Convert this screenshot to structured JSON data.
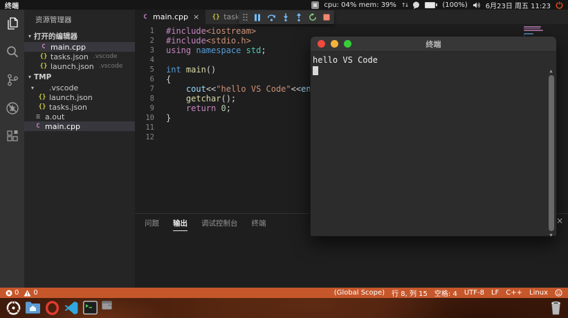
{
  "topbar": {
    "app": "终端",
    "cpu_mem": "cpu: 04% mem: 39%",
    "battery": "(100%)",
    "clock": "6月23日 周五 11:23"
  },
  "activity_bar": {
    "items": [
      {
        "name": "explorer",
        "icon": "files",
        "active": true
      },
      {
        "name": "search",
        "icon": "search",
        "active": false
      },
      {
        "name": "source-control",
        "icon": "git",
        "active": false
      },
      {
        "name": "debug",
        "icon": "debug",
        "active": false
      },
      {
        "name": "extensions",
        "icon": "extensions",
        "active": false
      }
    ]
  },
  "sidebar": {
    "title": "资源管理器",
    "open_editors_label": "打开的编辑器",
    "open_editors": [
      {
        "icon": "cpp",
        "label": "main.cpp",
        "selected": true
      },
      {
        "icon": "json",
        "label": "tasks.json",
        "suffix": ".vscode"
      },
      {
        "icon": "json",
        "label": "launch.json",
        "suffix": ".vscode"
      }
    ],
    "folder_label": "TMP",
    "tree": [
      {
        "icon": "folder",
        "label": ".vscode",
        "indent": 1,
        "arrow": true
      },
      {
        "icon": "json",
        "label": "launch.json",
        "indent": 2
      },
      {
        "icon": "json",
        "label": "tasks.json",
        "indent": 2
      },
      {
        "icon": "binary",
        "label": "a.out",
        "indent": 1
      },
      {
        "icon": "cpp",
        "label": "main.cpp",
        "indent": 1,
        "selected": true
      }
    ]
  },
  "tabs": [
    {
      "icon": "cpp",
      "label": "main.cpp",
      "active": true,
      "close": true
    },
    {
      "icon": "json",
      "label": "tasks.json",
      "active": false,
      "close": false
    }
  ],
  "debug_toolbar": {
    "buttons": [
      "drag-handle",
      "pause",
      "step-over",
      "step-into",
      "step-out",
      "restart",
      "stop"
    ]
  },
  "editor": {
    "token_colors": {
      "pp": "#C586C0",
      "kw": "#569CD6",
      "type": "#4EC9B0",
      "fn": "#DCDCAA",
      "var": "#9CDCFE",
      "str": "#CE9178",
      "num": "#B5CEA8",
      "pl": "#D4D4D4"
    },
    "lines": [
      [
        {
          "t": "#include",
          "c": "pp"
        },
        {
          "t": "<iostream>",
          "c": "str"
        }
      ],
      [
        {
          "t": "#include",
          "c": "pp"
        },
        {
          "t": "<stdio.h>",
          "c": "str"
        }
      ],
      [
        {
          "t": "using",
          "c": "pp"
        },
        {
          "t": " ",
          "c": "pl"
        },
        {
          "t": "namespace",
          "c": "kw"
        },
        {
          "t": " ",
          "c": "pl"
        },
        {
          "t": "std",
          "c": "type"
        },
        {
          "t": ";",
          "c": "pl"
        }
      ],
      [],
      [
        {
          "t": "int",
          "c": "kw"
        },
        {
          "t": " ",
          "c": "pl"
        },
        {
          "t": "main",
          "c": "fn"
        },
        {
          "t": "()",
          "c": "pl"
        }
      ],
      [
        {
          "t": "{",
          "c": "pl"
        }
      ],
      [
        {
          "t": "    ",
          "c": "pl"
        },
        {
          "t": "cout",
          "c": "var"
        },
        {
          "t": "<<",
          "c": "pl"
        },
        {
          "t": "\"hello VS Code\"",
          "c": "str"
        },
        {
          "t": "<<",
          "c": "pl"
        },
        {
          "t": "endl",
          "c": "var"
        },
        {
          "t": ";",
          "c": "pl"
        }
      ],
      [
        {
          "t": "    ",
          "c": "pl"
        },
        {
          "t": "getchar",
          "c": "fn"
        },
        {
          "t": "();",
          "c": "pl"
        }
      ],
      [
        {
          "t": "    ",
          "c": "pl"
        },
        {
          "t": "return",
          "c": "pp"
        },
        {
          "t": " ",
          "c": "pl"
        },
        {
          "t": "0",
          "c": "num"
        },
        {
          "t": ";",
          "c": "pl"
        }
      ],
      [
        {
          "t": "}",
          "c": "pl"
        }
      ],
      [],
      []
    ]
  },
  "panel": {
    "tabs": [
      {
        "label": "问题",
        "active": false
      },
      {
        "label": "输出",
        "active": true
      },
      {
        "label": "调试控制台",
        "active": false
      },
      {
        "label": "终端",
        "active": false
      }
    ]
  },
  "statusbar": {
    "errors": "0",
    "warnings": "0",
    "right_items": [
      {
        "name": "symbol-scope",
        "label": "(Global Scope)"
      },
      {
        "name": "cursor-position",
        "label": "行 8, 列 15"
      },
      {
        "name": "indentation",
        "label": "空格: 4"
      },
      {
        "name": "encoding",
        "label": "UTF-8"
      },
      {
        "name": "eol",
        "label": "LF"
      },
      {
        "name": "language-mode",
        "label": "C++"
      },
      {
        "name": "os",
        "label": "Linux"
      }
    ],
    "background": "#C6572B"
  },
  "terminal_window": {
    "title": "终端",
    "output": "hello VS Code"
  },
  "desktop": {
    "dock": [
      "ubuntu-launcher",
      "file-manager",
      "opera-browser",
      "vscode",
      "terminal-app",
      "window-thumbnail"
    ]
  },
  "icons": {
    "close": "×",
    "chevron_down": "▾",
    "file_glyphs": {
      "cpp": "C",
      "json": "{}",
      "binary": "≡",
      "folder": ""
    }
  }
}
